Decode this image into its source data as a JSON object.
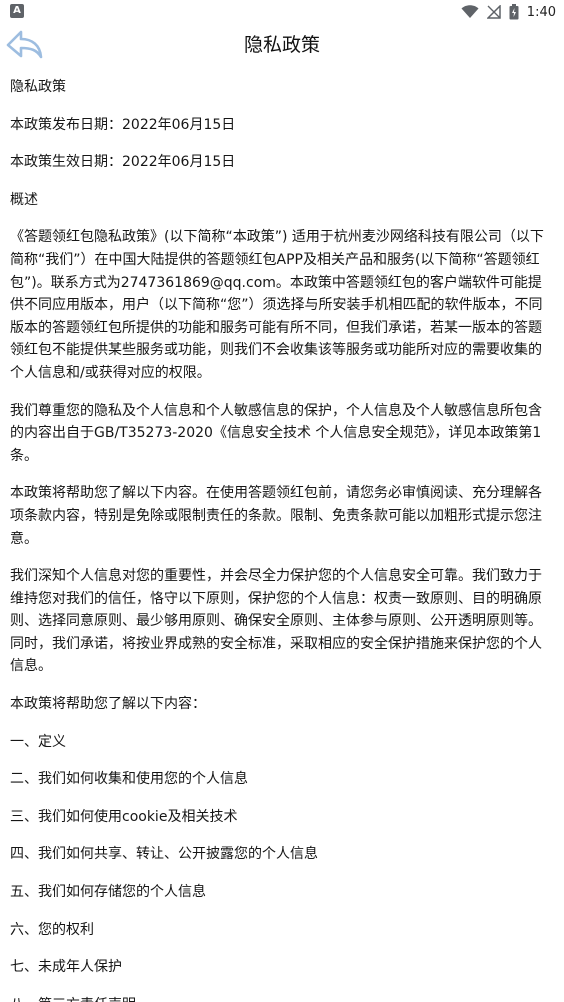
{
  "status_bar": {
    "left_icon_label": "A",
    "time": "1:40",
    "icons": [
      "wifi-icon",
      "signal-icon",
      "battery-icon"
    ]
  },
  "header": {
    "title": "隐私政策",
    "back_icon": "back-arrow-icon"
  },
  "content": {
    "heading": "隐私政策",
    "publish_date": "本政策发布日期：2022年06月15日",
    "effective_date": "本政策生效日期：2022年06月15日",
    "overview_label": "概述",
    "paragraphs": [
      "《答题领红包隐私政策》(以下简称“本政策”) 适用于杭州麦沙网络科技有限公司（以下简称“我们”）在中国大陆提供的答题领红包APP及相关产品和服务(以下简称“答题领红包”)。联系方式为2747361869@qq.com。本政策中答题领红包的客户端软件可能提供不同应用版本，用户（以下简称“您”）须选择与所安装手机相匹配的软件版本，不同版本的答题领红包所提供的功能和服务可能有所不同，但我们承诺，若某一版本的答题领红包不能提供某些服务或功能，则我们不会收集该等服务或功能所对应的需要收集的个人信息和/或获得对应的权限。",
      "我们尊重您的隐私及个人信息和个人敏感信息的保护，个人信息及个人敏感信息所包含的内容出自于GB/T35273-2020《信息安全技术 个人信息安全规范》，详见本政策第1条。",
      "本政策将帮助您了解以下内容。在使用答题领红包前，请您务必审慎阅读、充分理解各项条款内容，特别是免除或限制责任的条款。限制、免责条款可能以加粗形式提示您注意。",
      "我们深知个人信息对您的重要性，并会尽全力保护您的个人信息安全可靠。我们致力于维持您对我们的信任，恪守以下原则，保护您的个人信息：权责一致原则、目的明确原则、选择同意原则、最少够用原则、确保安全原则、主体参与原则、公开透明原则等。同时，我们承诺，将按业界成熟的安全标准，采取相应的安全保护措施来保护您的个人信息。"
    ],
    "toc_intro": "本政策将帮助您了解以下内容：",
    "toc": [
      "一、定义",
      "二、我们如何收集和使用您的个人信息",
      "三、我们如何使用cookie及相关技术",
      "四、我们如何共享、转让、公开披露您的个人信息",
      "五、我们如何存储您的个人信息",
      "六、您的权利",
      "七、未成年人保护",
      "八、第三方责任声明"
    ]
  },
  "colors": {
    "back_arrow": "#9dbde0",
    "text": "#161616",
    "background": "#ffffff"
  }
}
